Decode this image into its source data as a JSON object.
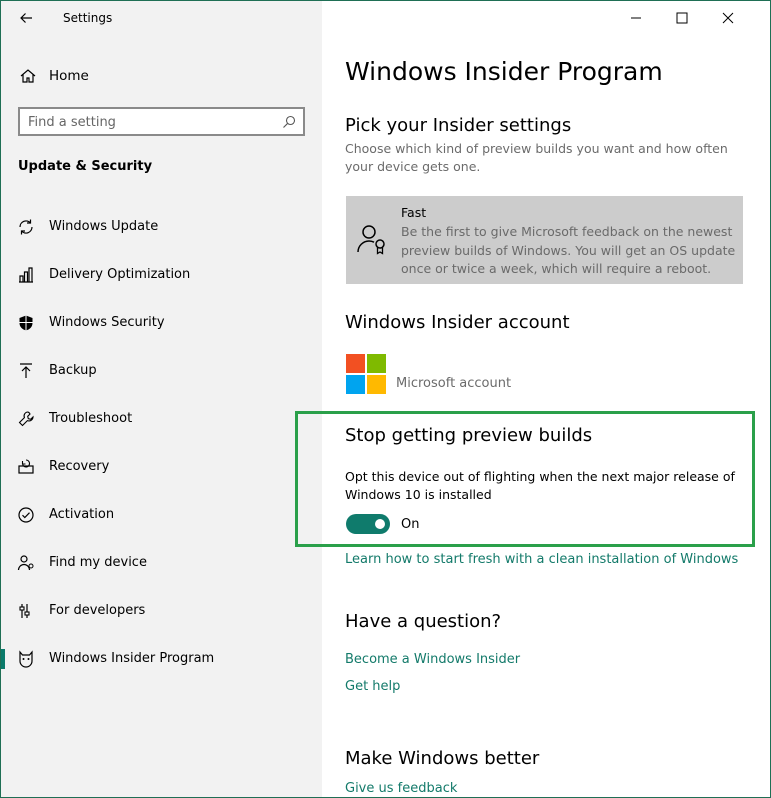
{
  "app": {
    "title": "Settings",
    "back_icon": "back-arrow-icon"
  },
  "window_controls": {
    "minimize": "minimize-icon",
    "maximize": "maximize-icon",
    "close": "close-icon"
  },
  "sidebar": {
    "home_label": "Home",
    "search": {
      "placeholder": "Find a setting"
    },
    "section_title": "Update & Security",
    "items": [
      {
        "label": "Windows Update",
        "icon": "sync-icon"
      },
      {
        "label": "Delivery Optimization",
        "icon": "delivery-icon"
      },
      {
        "label": "Windows Security",
        "icon": "shield-icon"
      },
      {
        "label": "Backup",
        "icon": "upload-arrow-icon"
      },
      {
        "label": "Troubleshoot",
        "icon": "wrench-icon"
      },
      {
        "label": "Recovery",
        "icon": "recovery-icon"
      },
      {
        "label": "Activation",
        "icon": "check-circle-icon"
      },
      {
        "label": "Find my device",
        "icon": "person-locate-icon"
      },
      {
        "label": "For developers",
        "icon": "developer-sliders-icon"
      },
      {
        "label": "Windows Insider Program",
        "icon": "insider-cat-icon",
        "active": true
      }
    ],
    "accent": "#0a7a6a"
  },
  "main": {
    "page_title": "Windows Insider Program",
    "pick_settings": {
      "heading": "Pick your Insider settings",
      "description": "Choose which kind of preview builds you want and how often your device gets one.",
      "card": {
        "title": "Fast",
        "text": "Be the first to give Microsoft feedback on the newest preview builds of Windows. You will get an OS update once or twice a week, which will require a reboot."
      }
    },
    "account": {
      "heading": "Windows Insider account",
      "account_label": "Microsoft account"
    },
    "stop_builds": {
      "heading": "Stop getting preview builds",
      "description": "Opt this device out of flighting when the next major release of Windows 10 is installed",
      "toggle_state": "On",
      "toggle_color": "#0f7b6c",
      "highlight_color": "#2aa04a"
    },
    "clean_install_link": "Learn how to start fresh with a clean installation of Windows",
    "question": {
      "heading": "Have a question?",
      "links": [
        "Become a Windows Insider",
        "Get help"
      ]
    },
    "better": {
      "heading": "Make Windows better",
      "feedback_link": "Give us feedback"
    },
    "link_color": "#137a6a"
  }
}
